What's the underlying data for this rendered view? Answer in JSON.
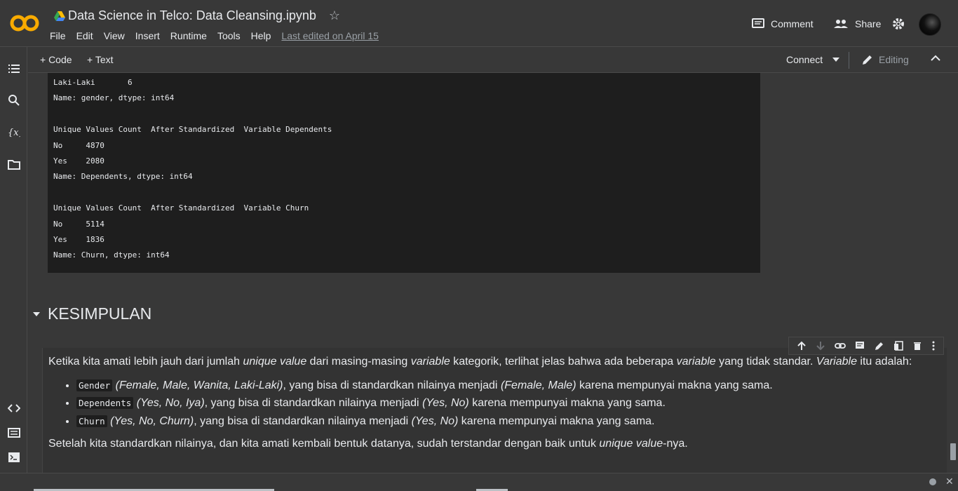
{
  "app": {
    "logo_text": "CO",
    "notebook_title": "Data Science in Telco: Data Cleansing.ipynb",
    "menu": [
      "File",
      "Edit",
      "View",
      "Insert",
      "Runtime",
      "Tools",
      "Help"
    ],
    "last_edited": "Last edited on April 15",
    "comment_label": "Comment",
    "share_label": "Share"
  },
  "toolbar": {
    "add_code": "+ Code",
    "add_text": "+ Text",
    "connect": "Connect",
    "editing": "Editing"
  },
  "output_lines": [
    "Laki-Laki       6",
    "Name: gender, dtype: int64",
    "",
    "Unique Values Count  After Standardized  Variable Dependents",
    "No     4870",
    "Yes    2080",
    "Name: Dependents, dtype: int64",
    "",
    "Unique Values Count  After Standardized  Variable Churn",
    "No     5114",
    "Yes    1836",
    "Name: Churn, dtype: int64"
  ],
  "section": {
    "heading": "KESIMPULAN"
  },
  "text_cell": {
    "p1_a": "Ketika kita amati lebih jauh dari jumlah ",
    "p1_b": "unique value",
    "p1_c": " dari masing-masing ",
    "p1_d": "variable",
    "p1_e": " kategorik, terlihat jelas bahwa ada beberapa ",
    "p1_f": "variable",
    "p1_g": " yang tidak standar. ",
    "p1_h": "Variable",
    "p1_i": " itu adalah:",
    "items": [
      {
        "code": "Gender",
        "values": "(Female, Male, Wanita, Laki-Laki)",
        "mid": ", yang bisa di standardkan nilainya menjadi ",
        "std": "(Female, Male)",
        "end": " karena mempunyai makna yang sama."
      },
      {
        "code": "Dependents",
        "values": "(Yes, No, Iya)",
        "mid": ", yang bisa di standardkan nilainya menjadi ",
        "std": "(Yes, No)",
        "end": " karena mempunyai makna yang sama."
      },
      {
        "code": "Churn",
        "values": "(Yes, No, Churn)",
        "mid": ", yang bisa di standardkan nilainya menjadi ",
        "std": "(Yes, No)",
        "end": " karena mempunyai makna yang sama."
      }
    ],
    "p2_a": "Setelah kita standardkan nilainya, dan kita amati kembali bentuk datanya, sudah terstandar dengan baik untuk ",
    "p2_b": "unique value",
    "p2_c": "-nya."
  },
  "icons": {
    "rail": [
      "table-of-contents-icon",
      "search-icon",
      "variables-icon",
      "files-icon",
      "code-snippets-icon",
      "command-palette-icon",
      "terminal-icon"
    ],
    "cell_tools": [
      "move-up-icon",
      "move-down-icon",
      "link-icon",
      "comment-icon",
      "edit-icon",
      "mirror-cell-icon",
      "delete-icon",
      "more-icon"
    ]
  }
}
